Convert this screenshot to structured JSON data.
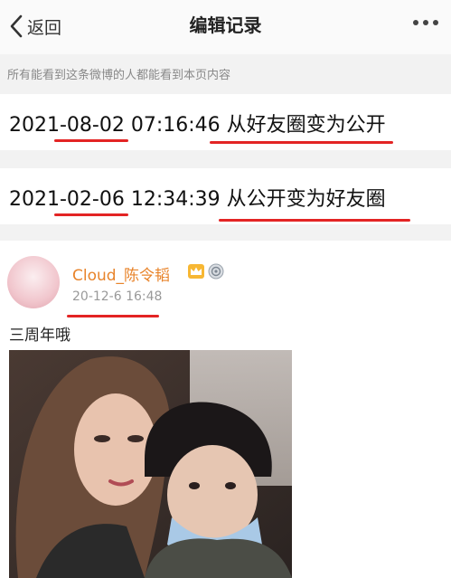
{
  "nav": {
    "back_label": "返回",
    "title": "编辑记录"
  },
  "notice": "所有能看到这条微博的人都能看到本页内容",
  "records": [
    {
      "time": "2021-08-02 07:16:46",
      "change": "从好友圈变为公开"
    },
    {
      "time": "2021-02-06 12:34:39",
      "change": "从公开变为好友圈"
    }
  ],
  "post": {
    "username": "Cloud_陈令韬",
    "timestamp": "20-12-6 16:48",
    "text": "三周年哦",
    "badges": [
      "crown-icon",
      "medal-icon"
    ]
  },
  "colors": {
    "underline": "#e32424",
    "username": "#e8842b"
  }
}
